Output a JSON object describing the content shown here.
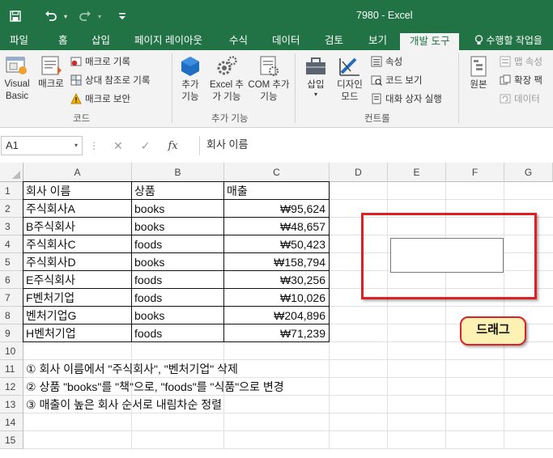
{
  "window": {
    "title": "7980 - Excel",
    "quick_access": [
      "save-icon",
      "undo-icon",
      "redo-icon",
      "customize-icon"
    ]
  },
  "tabs": [
    {
      "label": "파일",
      "active": false
    },
    {
      "label": "홈",
      "active": false
    },
    {
      "label": "삽입",
      "active": false
    },
    {
      "label": "페이지 레이아웃",
      "active": false
    },
    {
      "label": "수식",
      "active": false
    },
    {
      "label": "데이터",
      "active": false
    },
    {
      "label": "검토",
      "active": false
    },
    {
      "label": "보기",
      "active": false
    },
    {
      "label": "개발 도구",
      "active": true
    }
  ],
  "tell_me": "수행할 작업을",
  "ribbon": {
    "code": {
      "label": "코드",
      "visual_basic": "Visual Basic",
      "macro": "매크로",
      "record_macro": "매크로 기록",
      "relative_ref": "상대 참조로 기록",
      "macro_security": "매크로 보안"
    },
    "addins": {
      "label": "추가 기능",
      "addins": "추가 기능",
      "excel_addins": "Excel 추가 기능",
      "com_addins": "COM 추가 기능"
    },
    "controls": {
      "label": "컨트롤",
      "insert": "삽입",
      "design_mode": "디자인 모드",
      "properties": "속성",
      "view_code": "코드 보기",
      "run_dialog": "대화 상자 실행"
    },
    "xml": {
      "source": "원본",
      "map_properties": "맵 속성",
      "expansion_packs": "확장 팩",
      "refresh_data": "데이터"
    }
  },
  "formula_bar": {
    "name_box": "A1",
    "content": "회사 이름"
  },
  "sheet": {
    "columns": [
      "A",
      "B",
      "C",
      "D",
      "E",
      "F",
      "G"
    ],
    "rows": [
      "1",
      "2",
      "3",
      "4",
      "5",
      "6",
      "7",
      "8",
      "9",
      "10",
      "11",
      "12",
      "13",
      "14",
      "15"
    ],
    "table_header": [
      "회사 이름",
      "상품",
      "매출"
    ],
    "table_rows": [
      [
        "주식회사A",
        "books",
        "₩95,624"
      ],
      [
        "B주식회사",
        "books",
        "₩48,657"
      ],
      [
        "주식회사C",
        "foods",
        "₩50,423"
      ],
      [
        "주식회사D",
        "books",
        "₩158,794"
      ],
      [
        "E주식회사",
        "foods",
        "₩30,256"
      ],
      [
        "F벤처기업",
        "foods",
        "₩10,026"
      ],
      [
        "벤처기업G",
        "books",
        "₩204,896"
      ],
      [
        "H벤처기업",
        "foods",
        "₩71,239"
      ]
    ],
    "notes": [
      "① 회사 이름에서 \"주식회사\", \"벤처기업\" 삭제",
      "② 상품 \"books\"를 \"책\"으로, \"foods\"를 \"식품\"으로 변경",
      "③ 매출이 높은 회사 순서로 내림차순 정렬"
    ]
  },
  "annotation": {
    "callout": "드래그",
    "highlight_color": "#e02020",
    "callout_fill": "#fdf1b3"
  }
}
